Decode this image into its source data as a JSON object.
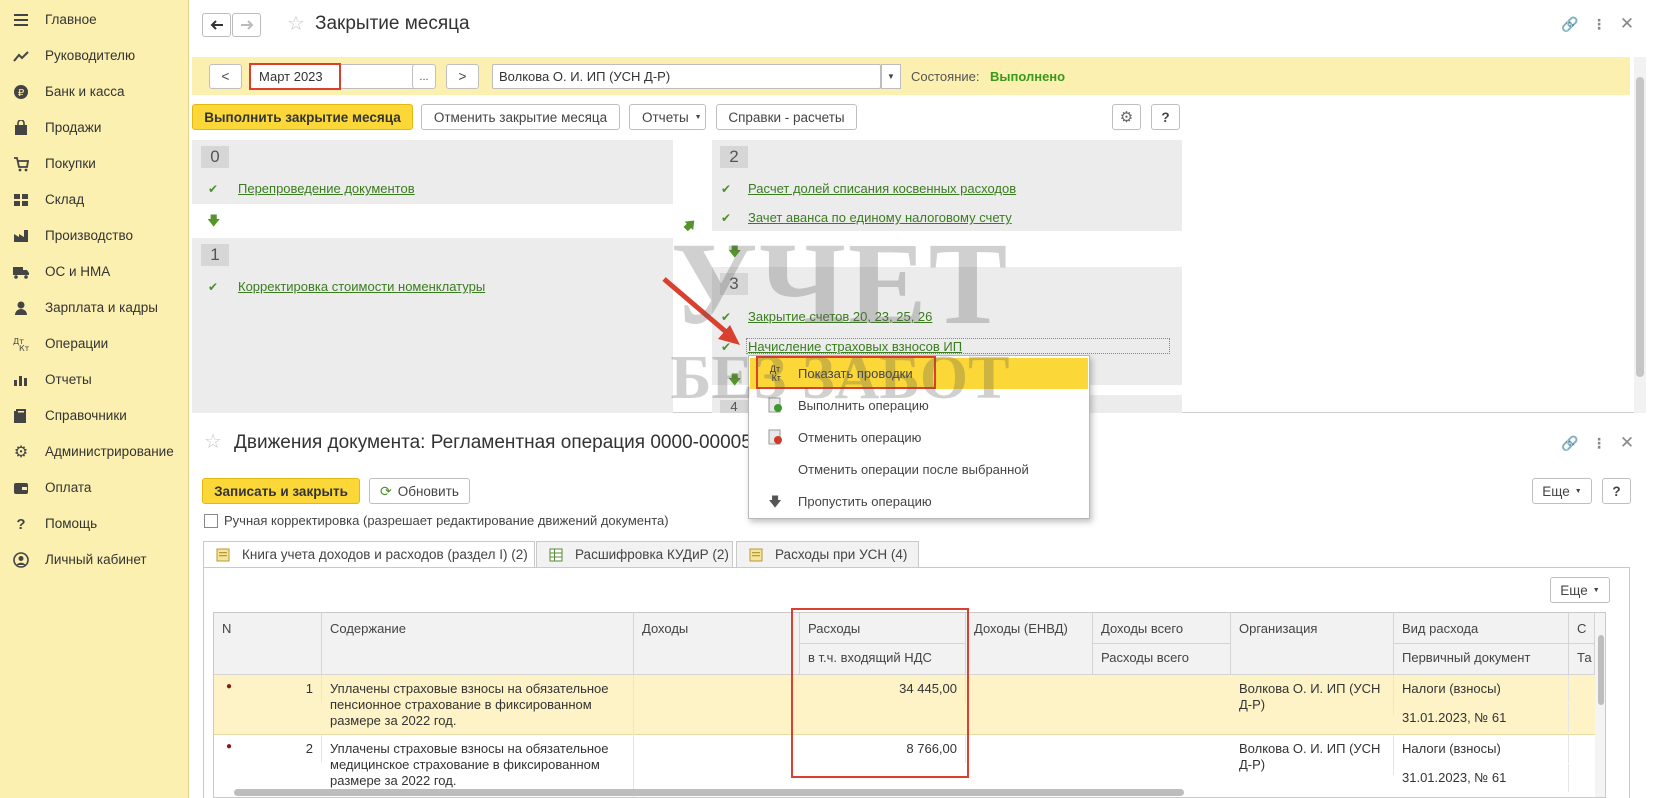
{
  "sidebar": {
    "items": [
      {
        "label": "Главное",
        "icon": "menu-icon"
      },
      {
        "label": "Руководителю",
        "icon": "trend-icon"
      },
      {
        "label": "Банк и касса",
        "icon": "ruble-icon"
      },
      {
        "label": "Продажи",
        "icon": "bag-icon"
      },
      {
        "label": "Покупки",
        "icon": "cart-icon"
      },
      {
        "label": "Склад",
        "icon": "grid-icon"
      },
      {
        "label": "Производство",
        "icon": "factory-icon"
      },
      {
        "label": "ОС и НМА",
        "icon": "truck-icon"
      },
      {
        "label": "Зарплата и кадры",
        "icon": "person-icon"
      },
      {
        "label": "Операции",
        "icon": "dt-kt-icon"
      },
      {
        "label": "Отчеты",
        "icon": "chart-icon"
      },
      {
        "label": "Справочники",
        "icon": "book-icon"
      },
      {
        "label": "Администрирование",
        "icon": "gear-icon"
      },
      {
        "label": "Оплата",
        "icon": "wallet-icon"
      },
      {
        "label": "Помощь",
        "icon": "question-icon"
      },
      {
        "label": "Личный кабинет",
        "icon": "user-circle-icon"
      }
    ]
  },
  "closing": {
    "title": "Закрытие месяца",
    "prev": "<",
    "next": ">",
    "period": "Март 2023",
    "period_more": "...",
    "org": "Волкова О. И. ИП (УСН Д-Р)",
    "state_label": "Состояние:",
    "state_value": "Выполнено",
    "btn_execute": "Выполнить закрытие месяца",
    "btn_cancel": "Отменить закрытие месяца",
    "btn_reports": "Отчеты",
    "btn_calc": "Справки - расчеты",
    "btn_help": "?",
    "s0_num": "0",
    "s0_l1": "Перепроведение документов",
    "s1_num": "1",
    "s1_l1": "Корректировка стоимости номенклатуры",
    "s2_num": "2",
    "s2_l1": "Расчет долей списания косвенных расходов",
    "s2_l2": "Зачет аванса по единому налоговому счету",
    "s3_num": "3",
    "s3_l1": "Закрытие счетов 20, 23, 25, 26",
    "s3_l2": "Начисление страховых взносов ИП",
    "s4_num": "4"
  },
  "menu": {
    "items": [
      {
        "label": "Показать проводки",
        "icon": "dt-kt-icon"
      },
      {
        "label": "Выполнить операцию",
        "icon": "run-doc-icon"
      },
      {
        "label": "Отменить операцию",
        "icon": "cancel-doc-icon"
      },
      {
        "label": "Отменить операции после выбранной",
        "icon": ""
      },
      {
        "label": "Пропустить операцию",
        "icon": "arrow-down-icon"
      }
    ]
  },
  "movements": {
    "title": "Движения документа: Регламентная операция 0000-00005",
    "btn_save": "Записать и закрыть",
    "btn_refresh": "Обновить",
    "btn_more": "Еще",
    "btn_help": "?",
    "manual": "Ручная корректировка (разрешает редактирование движений документа)",
    "tabs": [
      "Книга учета доходов и расходов (раздел I) (2)",
      "Расшифровка КУДиР (2)",
      "Расходы при УСН (4)"
    ],
    "grid_more": "Еще",
    "columns": {
      "n": "N",
      "content": "Содержание",
      "income": "Доходы",
      "expenses": "Расходы",
      "expenses_sub": "в т.ч. входящий НДС",
      "income_envd": "Доходы (ЕНВД)",
      "income_total": "Доходы всего",
      "expenses_total": "Расходы всего",
      "org": "Организация",
      "exp_type": "Вид расхода",
      "primary_doc": "Первичный документ",
      "extra": "С",
      "extra_sub": "Та"
    },
    "rows": [
      {
        "n": "1",
        "content": "Уплачены страховые взносы на обязательное пенсионное страхование в фиксированном размере за 2022 год.",
        "expenses": "34 445,00",
        "org": "Волкова О. И. ИП (УСН Д-Р)",
        "exp_type": "Налоги (взносы)",
        "doc": "31.01.2023, № 61"
      },
      {
        "n": "2",
        "content": "Уплачены страховые взносы на обязательное медицинское страхование в фиксированном размере за 2022 год.",
        "expenses": "8 766,00",
        "org": "Волкова О. И. ИП (УСН Д-Р)",
        "exp_type": "Налоги (взносы)",
        "doc": "31.01.2023, № 61"
      }
    ]
  },
  "watermark": {
    "line1": "УЧЕТ",
    "line2": "БЕЗ ЗАБОТ"
  },
  "colors": {
    "accent_yellow": "#fbd838",
    "sidebar": "#fbf0b0",
    "link_green": "#3a7d1f",
    "highlight_red": "#d9402f",
    "row_highlight": "#fdf3c6"
  }
}
